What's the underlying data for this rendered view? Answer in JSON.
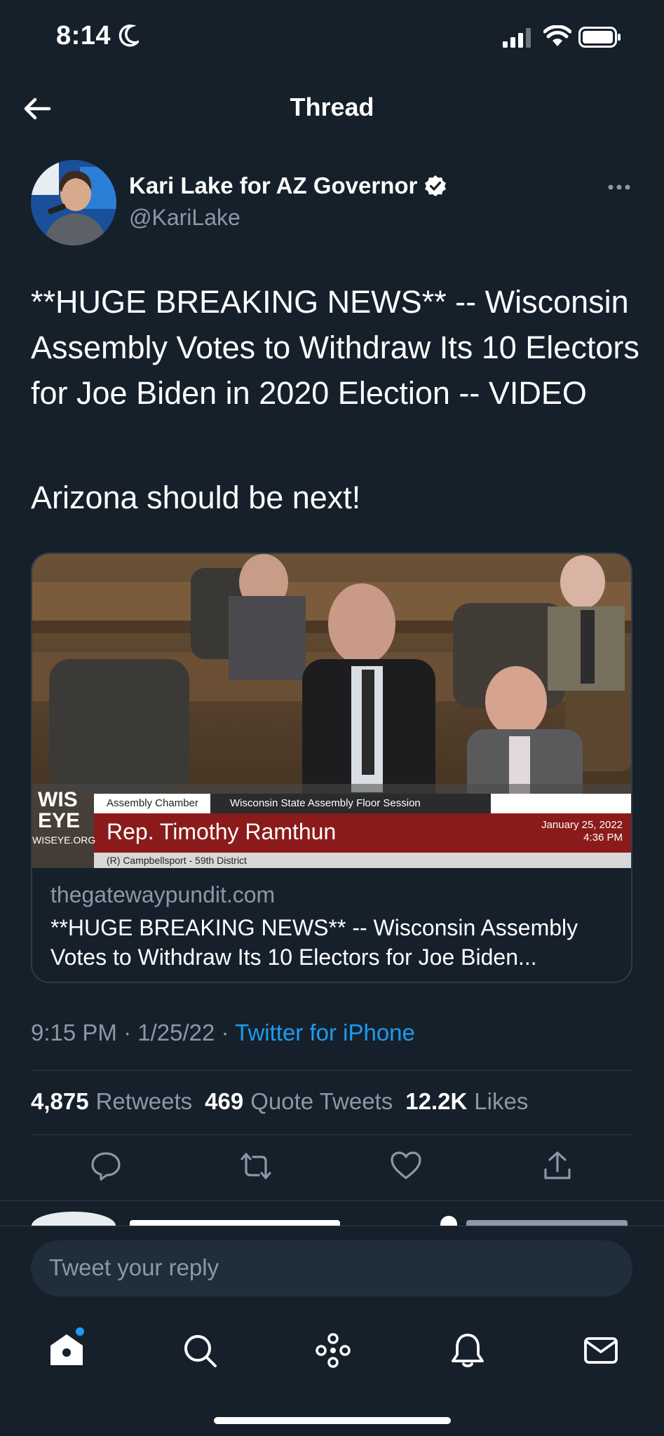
{
  "status_bar": {
    "time": "8:14"
  },
  "header": {
    "title": "Thread"
  },
  "author": {
    "name": "Kari Lake for AZ Governor",
    "handle": "@KariLake"
  },
  "tweet": {
    "text": "**HUGE BREAKING NEWS** -- Wisconsin Assembly Votes to Withdraw Its 10 Electors for Joe Biden in 2020 Election -- VIDEO",
    "text2": "Arizona should be next!"
  },
  "card": {
    "domain": "thegatewaypundit.com",
    "title": "**HUGE BREAKING NEWS** -- Wisconsin Assembly Votes to Withdraw Its 10 Electors for Joe Biden...",
    "media": {
      "logo_top": "WIS",
      "logo_bottom": "EYE",
      "logo_url": "WISEYE.ORG",
      "location_tag": "Assembly Chamber",
      "session": "Wisconsin State Assembly Floor Session",
      "speaker": "Rep. Timothy Ramthun",
      "district": "(R) Campbellsport - 59th District",
      "date": "January 25, 2022",
      "time": "4:36 PM"
    }
  },
  "meta": {
    "time": "9:15 PM",
    "date": "1/25/22",
    "sep": "·",
    "source": "Twitter for iPhone"
  },
  "stats": {
    "retweets_count": "4,875",
    "retweets_label": "Retweets",
    "quotes_count": "469",
    "quotes_label": "Quote Tweets",
    "likes_count": "12.2K",
    "likes_label": "Likes"
  },
  "reply": {
    "placeholder": "Tweet your reply"
  },
  "colors": {
    "background": "#15202b",
    "accent": "#1d9bf0",
    "muted": "#8b98a5",
    "border": "#2f3b47"
  }
}
